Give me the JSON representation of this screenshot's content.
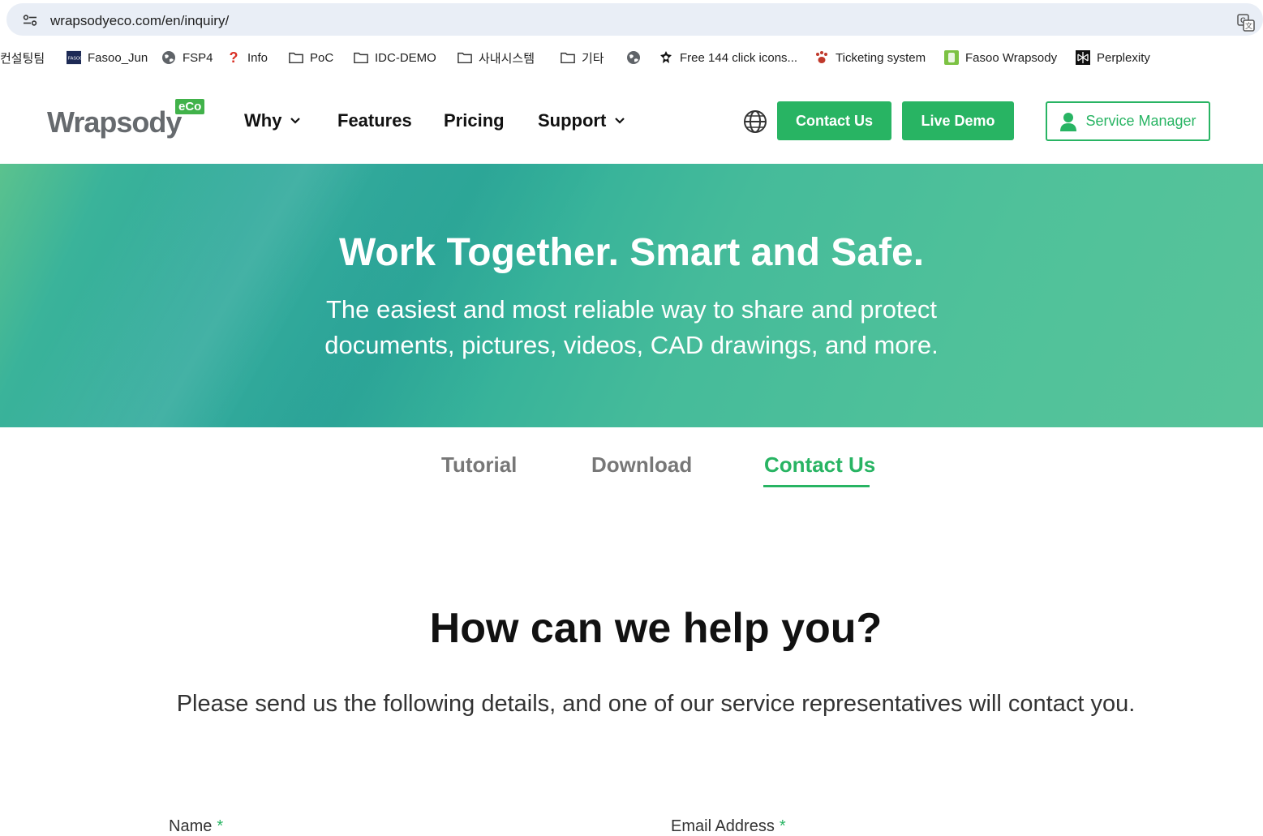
{
  "browser": {
    "url": "wrapsodyeco.com/en/inquiry/"
  },
  "bookmarks": [
    {
      "label": "컨설팅팀",
      "icon": "none"
    },
    {
      "label": "Fasoo_Jun",
      "icon": "fasoo-logo-icon"
    },
    {
      "label": "FSP4",
      "icon": "globe-icon"
    },
    {
      "label": "Info",
      "icon": "question-icon"
    },
    {
      "label": "PoC",
      "icon": "folder-icon"
    },
    {
      "label": "IDC-DEMO",
      "icon": "folder-icon"
    },
    {
      "label": "사내시스템",
      "icon": "folder-icon"
    },
    {
      "label": "기타",
      "icon": "folder-icon"
    },
    {
      "label": "",
      "icon": "globe-icon"
    },
    {
      "label": "Free 144 click icons...",
      "icon": "site-icon"
    },
    {
      "label": "Ticketing system",
      "icon": "paw-icon"
    },
    {
      "label": "Fasoo Wrapsody",
      "icon": "wrapsody-icon"
    },
    {
      "label": "Perplexity",
      "icon": "perplexity-icon"
    }
  ],
  "header": {
    "logo_text": "Wrapsody",
    "logo_badge": "eCo",
    "nav": {
      "why": "Why",
      "features": "Features",
      "pricing": "Pricing",
      "support": "Support"
    },
    "contact_us": "Contact Us",
    "live_demo": "Live Demo",
    "service_manager": "Service Manager"
  },
  "hero": {
    "title": "Work Together. Smart and Safe.",
    "subtitle_line1": "The easiest and most reliable way to share and protect",
    "subtitle_line2": "documents, pictures, videos, CAD drawings, and more."
  },
  "tabs": {
    "tutorial": "Tutorial",
    "download": "Download",
    "contact_us": "Contact Us",
    "active": "contact_us"
  },
  "content": {
    "title": "How can we help you?",
    "subtitle": "Please send us the following details, and one of our service representatives will contact you.",
    "name_label": "Name",
    "email_label": "Email Address",
    "required_mark": "*"
  },
  "colors": {
    "brand_green": "#28b463",
    "hero_teal": "#30a89a"
  }
}
